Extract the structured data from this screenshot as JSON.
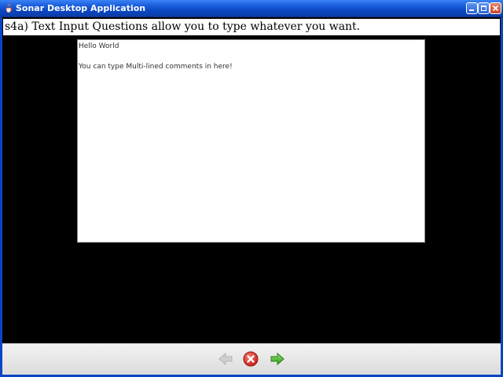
{
  "window": {
    "title": "Sonar Desktop Application",
    "icon": "java-cup-icon",
    "controls": [
      "minimize-icon",
      "maximize-icon",
      "close-icon"
    ]
  },
  "question": {
    "text": "s4a) Text Input Questions allow you to type whatever you want."
  },
  "text_input": {
    "lines": [
      "Hello World",
      "",
      "You can type Multi-lined comments in here!"
    ]
  },
  "navigation": {
    "back_icon": "back-arrow-icon",
    "back_enabled": false,
    "cancel_icon": "cancel-icon",
    "next_icon": "next-arrow-icon"
  },
  "colors": {
    "titlebar": "#0a45c3",
    "background": "#000000",
    "cancel": "#d9332b",
    "next": "#3fb42c",
    "back_disabled": "#c8c8c8"
  }
}
